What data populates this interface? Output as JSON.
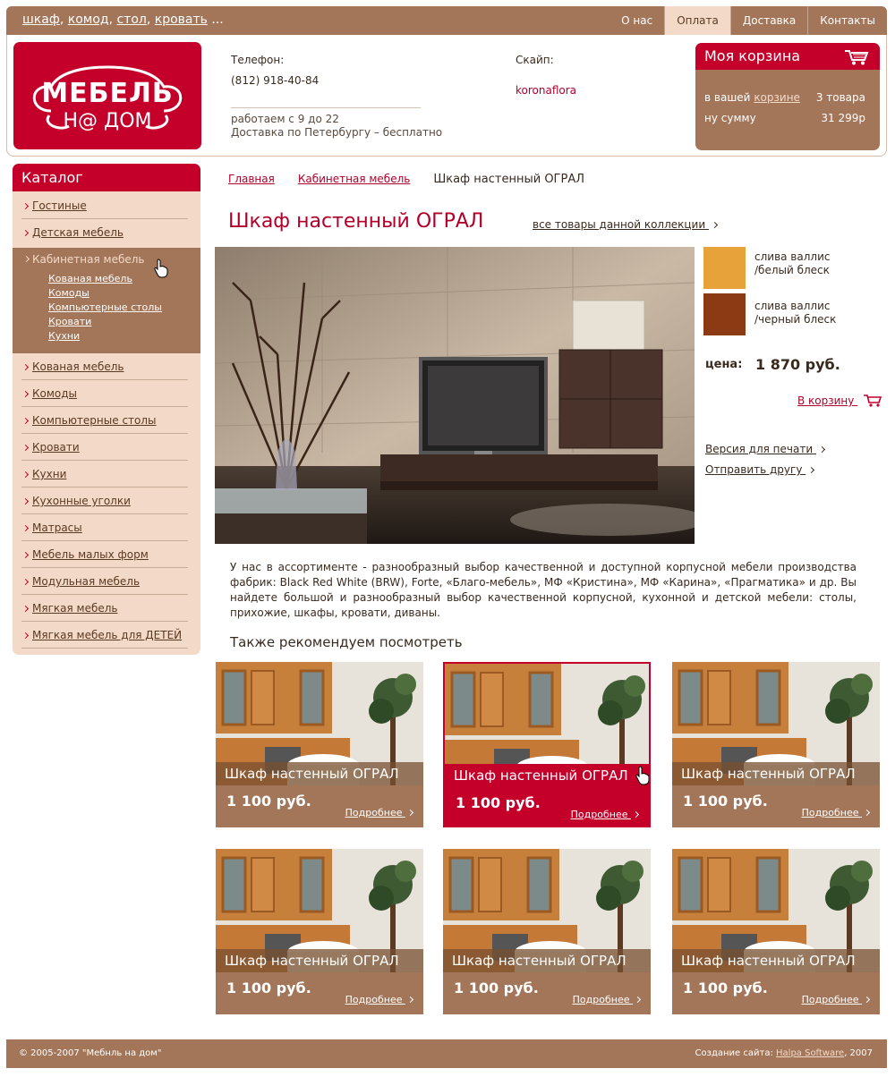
{
  "top": {
    "tags": [
      "шкаф",
      "комод",
      "стол",
      "кровать"
    ],
    "tags_more": "...",
    "nav": [
      {
        "label": "О нас",
        "active": false
      },
      {
        "label": "Оплата",
        "active": true
      },
      {
        "label": "Доставка",
        "active": false
      },
      {
        "label": "Контакты",
        "active": false
      }
    ]
  },
  "header": {
    "logo_line1": "МЕБЕЛЬ",
    "logo_line2": "Н@ ДОМ",
    "phone_label": "Телефон:",
    "phone_code": "(812)",
    "phone_number": "918-40-84",
    "hours": "работаем с 9 до 22",
    "delivery": "Доставка по Петербургу – бесплатно",
    "skype_label": "Скайп:",
    "skype_value": "koronaflora"
  },
  "cart": {
    "title": "Моя корзина",
    "line1_prefix": "в вашей",
    "line1_link": "корзине",
    "items_count": "3 товара",
    "line2_label": "ну сумму",
    "total": "31 299р"
  },
  "catalog": {
    "title": "Каталог",
    "items_top": [
      "Гостиные",
      "Детская мебель"
    ],
    "active_item": "Кабинетная мебель",
    "active_sub": [
      "Кованая мебель",
      "Комоды",
      "Компьютерные столы",
      "Кровати",
      "Кухни"
    ],
    "items_bottom": [
      "Кованая мебель",
      "Комоды",
      "Компьютерные столы",
      "Кровати",
      "Кухни",
      "Кухонные уголки",
      "Матрасы",
      "Мебель малых форм",
      "Модульная мебель",
      "Мягкая мебель",
      "Мягкая мебель для ДЕТЕЙ"
    ]
  },
  "breadcrumbs": {
    "home": "Главная",
    "section": "Кабинетная мебель",
    "current": "Шкаф настенный ОГРАЛ"
  },
  "product": {
    "title": "Шкаф настенный ОГРАЛ",
    "all_collection": "все товары данной коллекции",
    "swatches": [
      {
        "label1": "слива валлис",
        "label2": "/белый блеск",
        "color": "#e8a23a"
      },
      {
        "label1": "слива валлис",
        "label2": "/черный блеск",
        "color": "#8c3a14"
      }
    ],
    "price_label": "цена:",
    "price": "1 870 руб.",
    "to_cart": "В корзину",
    "print_version": "Версия для печати",
    "send_friend": "Отправить другу",
    "description": "У нас в ассортименте - разнообразный выбор качественной и доступной корпусной мебели производства фабрик: Black Red White (BRW), Forte, «Благо-мебель», МФ «Кристина», МФ «Карина», «Прагматика» и др. Вы найдете большой и разнообразный выбор качественной корпусной, кухонной и детской мебели: столы, прихожие, шкафы, кровати, диваны."
  },
  "recommend": {
    "title": "Также рекомендуем посмотреть",
    "cards": [
      {
        "name": "Шкаф настенный ОГРАЛ",
        "price": "1 100 руб.",
        "more": "Подробнее",
        "selected": false
      },
      {
        "name": "Шкаф настенный ОГРАЛ",
        "price": "1 100 руб.",
        "more": "Подробнее",
        "selected": true
      },
      {
        "name": "Шкаф настенный ОГРАЛ",
        "price": "1 100 руб.",
        "more": "Подробнее",
        "selected": false
      },
      {
        "name": "Шкаф настенный ОГРАЛ",
        "price": "1 100 руб.",
        "more": "Подробнее",
        "selected": false
      },
      {
        "name": "Шкаф настенный ОГРАЛ",
        "price": "1 100 руб.",
        "more": "Подробнее",
        "selected": false
      },
      {
        "name": "Шкаф настенный ОГРАЛ",
        "price": "1 100 руб.",
        "more": "Подробнее",
        "selected": false
      }
    ]
  },
  "footer": {
    "copyright": "© 2005-2007 \"Мебнль на дом\"",
    "credit_prefix": "Создание сайта:",
    "credit_link": "Halpa Software",
    "credit_year": ", 2007"
  },
  "colors": {
    "brown": "#a47659",
    "red": "#c4002a",
    "peach": "#f3d9c7"
  }
}
